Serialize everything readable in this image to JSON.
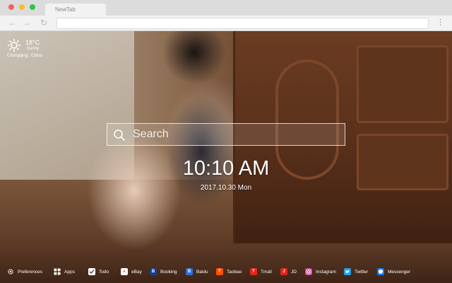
{
  "browser": {
    "tab_title": "NewTab"
  },
  "weather": {
    "icon": "sun-icon",
    "temperature": "18°C",
    "condition": "Sunny",
    "location": "Chongqing , China"
  },
  "search": {
    "placeholder": "Search"
  },
  "clock": {
    "time": "10:10 AM",
    "date": "2017.10.30 Mon"
  },
  "bottom_links": [
    {
      "label": "Preferences",
      "icon": "gear-icon",
      "color": "#ffffff"
    },
    {
      "label": "Apps",
      "icon": "grid-icon",
      "color": "#ffffff"
    },
    {
      "label": "Todo",
      "icon": "checkbox-icon",
      "color": "#ffffff"
    },
    {
      "label": "eBay",
      "icon": "ebay-icon",
      "color": "#ffffff"
    },
    {
      "label": "Booking",
      "icon": "booking-icon",
      "color": "#1b3d8a"
    },
    {
      "label": "Baidu",
      "icon": "baidu-icon",
      "color": "#2f6fe0"
    },
    {
      "label": "Taobao",
      "icon": "taobao-icon",
      "color": "#ff5000"
    },
    {
      "label": "Tmall",
      "icon": "tmall-icon",
      "color": "#e1251b"
    },
    {
      "label": "JD",
      "icon": "jd-icon",
      "color": "#e1251b"
    },
    {
      "label": "Instagram",
      "icon": "instagram-icon",
      "color": "#c1358c"
    },
    {
      "label": "Twitter",
      "icon": "twitter-icon",
      "color": "#1da1f2"
    },
    {
      "label": "Messenger",
      "icon": "messenger-icon",
      "color": "#0a7cff"
    }
  ]
}
